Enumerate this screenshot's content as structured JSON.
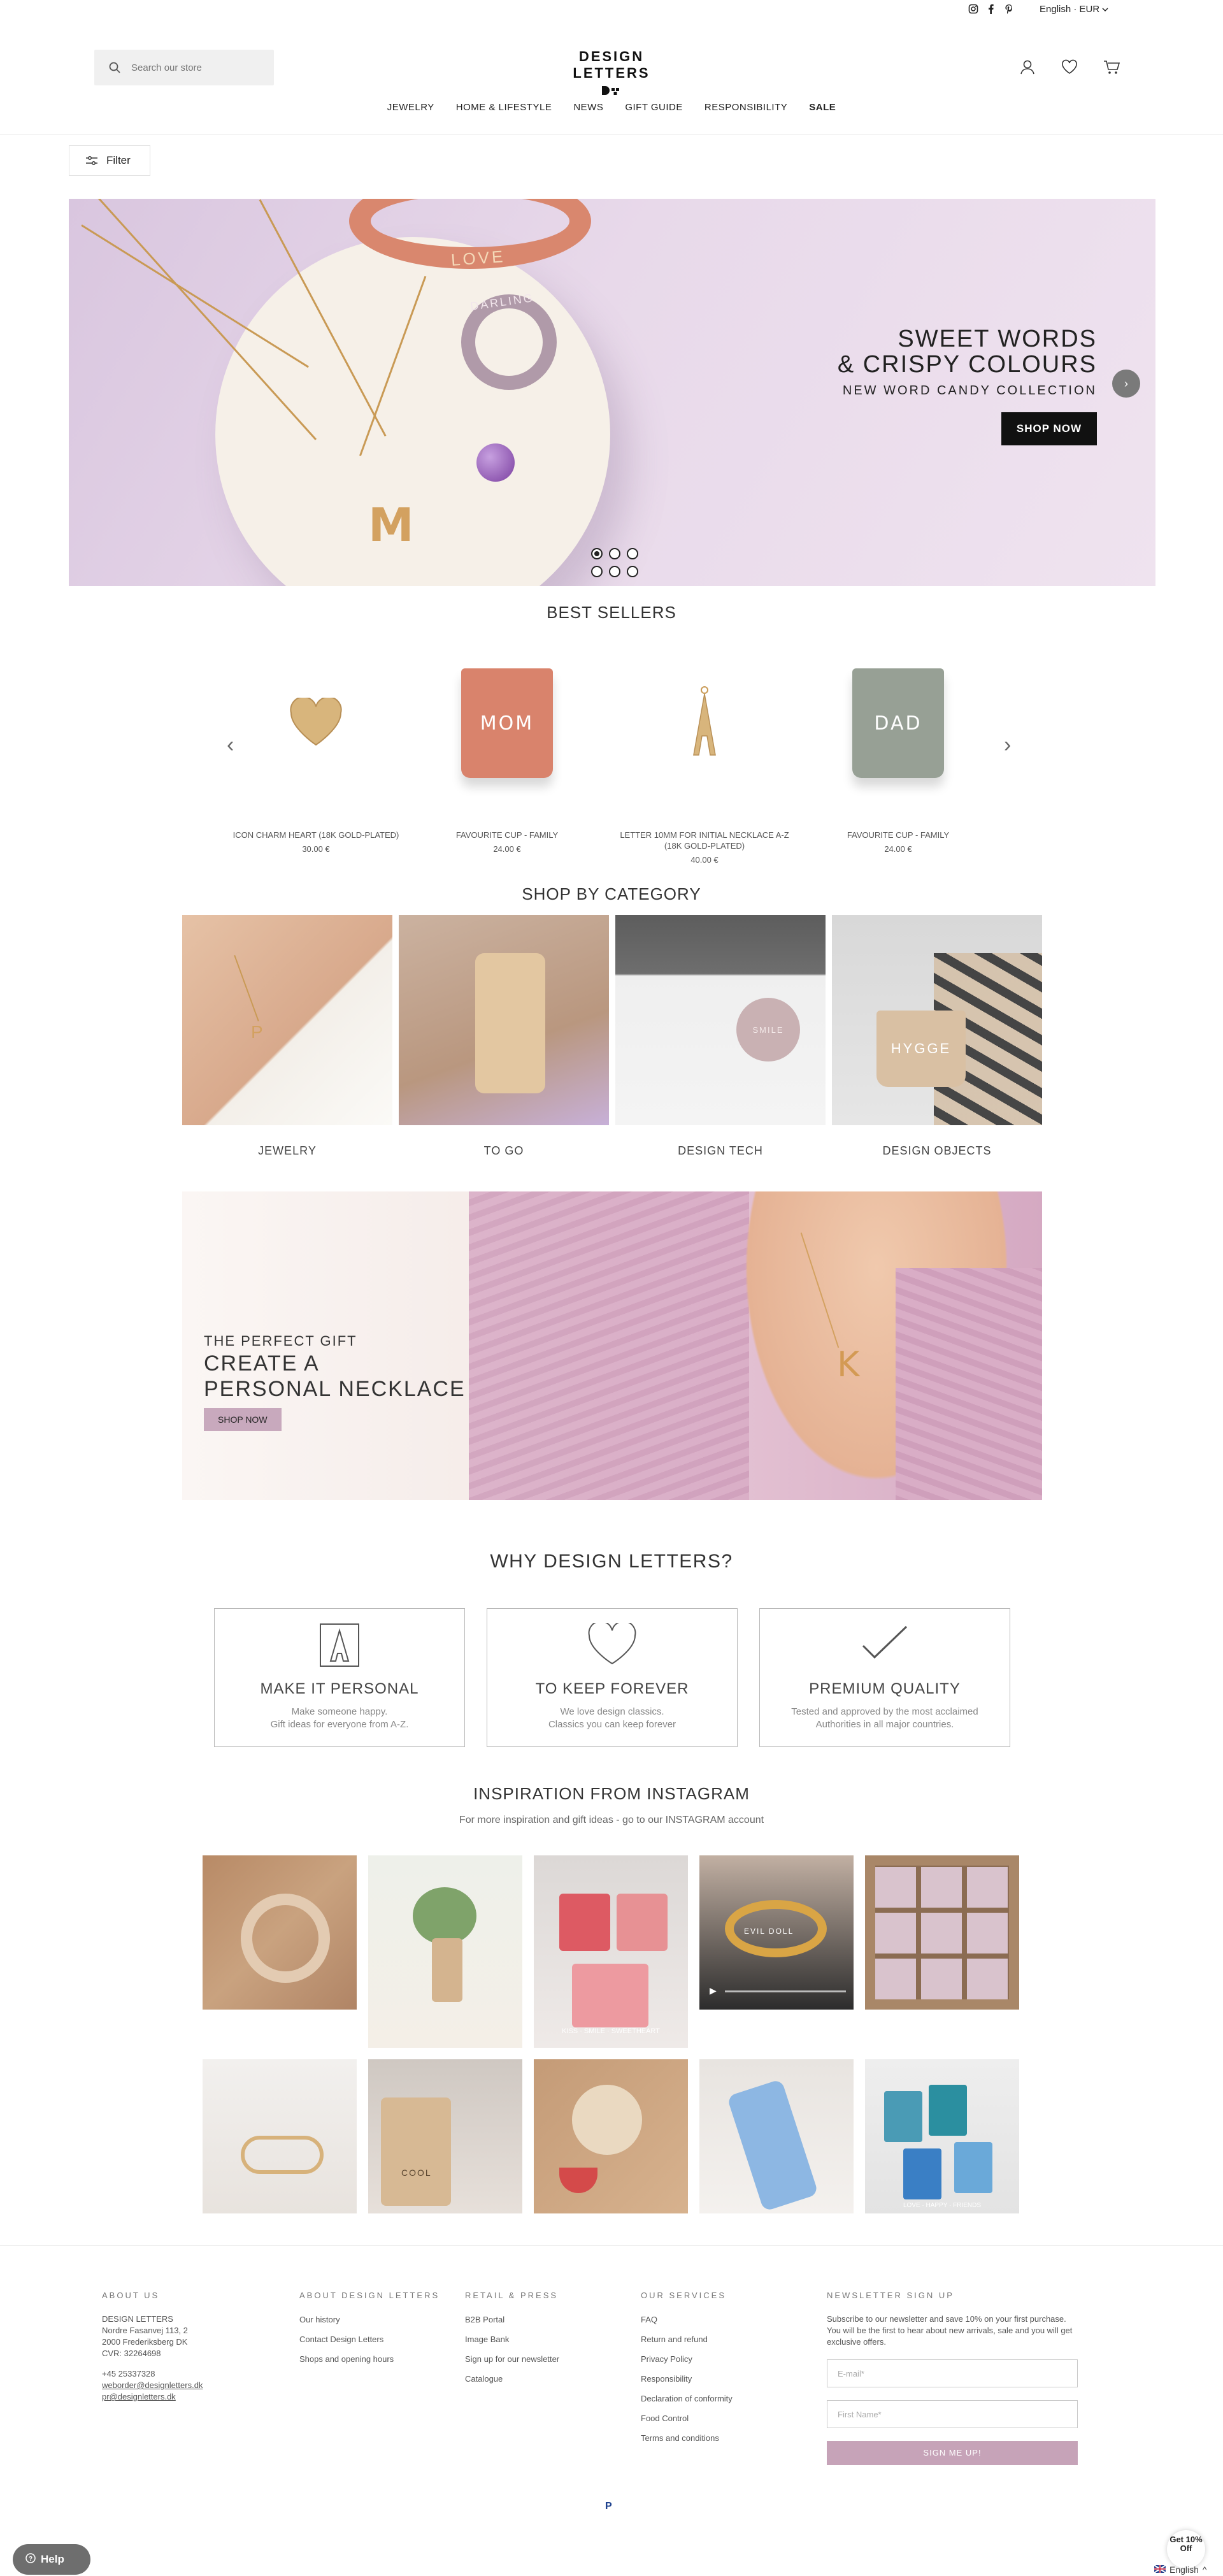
{
  "topbar": {
    "social_icons": [
      "instagram-icon",
      "facebook-icon",
      "pinterest-icon"
    ],
    "language": "English · EUR"
  },
  "header": {
    "search_placeholder": "Search our store",
    "logo_text": "DESIGN LETTERS",
    "nav": [
      "JEWELRY",
      "HOME & LIFESTYLE",
      "NEWS",
      "GIFT GUIDE",
      "RESPONSIBILITY",
      "SALE"
    ],
    "icons": [
      "account-icon",
      "wishlist-heart-icon",
      "cart-icon"
    ]
  },
  "filter": {
    "label": "Filter"
  },
  "hero": {
    "ring_text": "DARLING",
    "bangle_text": "LOVE",
    "line1": "SWEET WORDS",
    "line2": "& CRISPY COLOURS",
    "subline": "NEW WORD CANDY COLLECTION",
    "cta": "SHOP NOW",
    "slide_count": 6,
    "active_slide": 1,
    "colors": {
      "background": "#e3d4e6",
      "button": "#111111"
    }
  },
  "best_sellers": {
    "title": "BEST SELLERS",
    "products": [
      {
        "name": "ICON CHARM HEART (18K GOLD-PLATED)",
        "price": "30.00 €",
        "thumb": "gold-heart-charm"
      },
      {
        "name": "FAVOURITE CUP - FAMILY",
        "price": "24.00 €",
        "thumb_text": "MOM",
        "thumb_color": "#d9836c"
      },
      {
        "name": "LETTER 10MM FOR INITIAL NECKLACE A-Z (18K GOLD-PLATED)",
        "price": "40.00 €",
        "thumb": "gold-letter-a"
      },
      {
        "name": "FAVOURITE CUP - FAMILY",
        "price": "24.00 €",
        "thumb_text": "DAD",
        "thumb_color": "#97a095"
      }
    ]
  },
  "categories": {
    "title": "SHOP BY CATEGORY",
    "items": [
      {
        "label": "JEWELRY"
      },
      {
        "label": "TO GO"
      },
      {
        "label": "DESIGN TECH",
        "img_text": "SMILE"
      },
      {
        "label": "DESIGN OBJECTS",
        "img_text": "HYGGE"
      }
    ]
  },
  "banner": {
    "kicker": "THE PERFECT GIFT",
    "line1": "CREATE A",
    "line2": "PERSONAL NECKLACE",
    "cta": "SHOP NOW",
    "pendant_letter": "K"
  },
  "why": {
    "title": "WHY DESIGN LETTERS?",
    "items": [
      {
        "title": "MAKE IT PERSONAL",
        "desc1": "Make someone happy.",
        "desc2": "Gift ideas for everyone from A-Z.",
        "icon": "letter-a-tile-icon"
      },
      {
        "title": "TO KEEP FOREVER",
        "desc1": "We love design classics.",
        "desc2": "Classics you can keep forever",
        "icon": "heart-outline-icon"
      },
      {
        "title": "PREMIUM QUALITY",
        "desc1": "Tested and approved by the most acclaimed",
        "desc2": "Authorities in all major countries.",
        "icon": "checkmark-icon"
      }
    ]
  },
  "instagram": {
    "title": "INSPIRATION FROM INSTAGRAM",
    "subtitle": "For more inspiration and gift ideas - go to our INSTAGRAM account",
    "posts": [
      {
        "text": ""
      },
      {
        "text": ""
      },
      {
        "text": "KISS · SMILE · SWEETHEART"
      },
      {
        "text": "EVIL DOLL"
      },
      {
        "text": ""
      },
      {
        "text": ""
      },
      {
        "text": "COOL"
      },
      {
        "text": ""
      },
      {
        "text": ""
      },
      {
        "text": "LOVE · HAPPY · FRIENDS"
      }
    ]
  },
  "footer": {
    "about": {
      "heading": "ABOUT US",
      "lines": [
        "DESIGN LETTERS",
        "Nordre Fasanvej 113, 2",
        "2000 Frederiksberg DK",
        "CVR: 32264698"
      ],
      "phone": "+45 25337328",
      "emails": [
        "weborder@designletters.dk",
        "pr@designletters.dk"
      ]
    },
    "about_dl": {
      "heading": "ABOUT DESIGN LETTERS",
      "links": [
        "Our history",
        "Contact Design Letters",
        "Shops and opening hours"
      ]
    },
    "retail": {
      "heading": "RETAIL & PRESS",
      "links": [
        "B2B Portal",
        "Image Bank",
        "Sign up for our newsletter",
        "Catalogue"
      ]
    },
    "services": {
      "heading": "OUR SERVICES",
      "links": [
        "FAQ",
        "Return and refund",
        "Privacy Policy",
        "Responsibility",
        "Declaration of conformity",
        "Food Control",
        "Terms and conditions"
      ]
    },
    "newsletter": {
      "heading": "NEWSLETTER SIGN UP",
      "text": "Subscribe to our newsletter and save 10% on your first purchase. You will be the first to hear about new arrivals, sale and you will get exclusive offers.",
      "email_placeholder": "E-mail*",
      "name_placeholder": "First Name*",
      "button": "SIGN ME UP!"
    },
    "payment": "P",
    "help_label": "Help",
    "promo": "Get 10% Off",
    "language_picker": "English"
  }
}
